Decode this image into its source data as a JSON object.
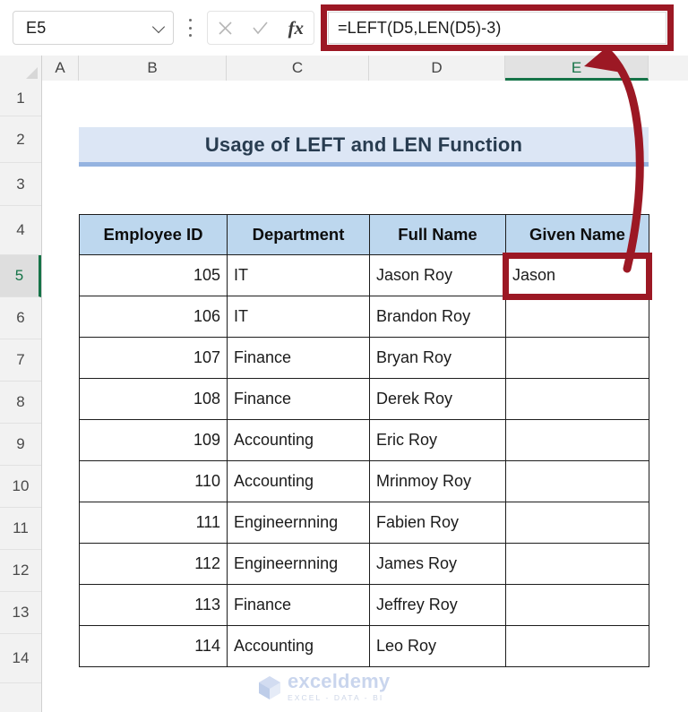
{
  "app": {
    "name_box": {
      "value": "E5",
      "icon": "chevron-down-icon"
    },
    "kebab": "more-options-icon",
    "cancel_icon": "close-icon",
    "enter_icon": "check-icon",
    "insert_function_icon": "fx",
    "formula": "=LEFT(D5,LEN(D5)-3)",
    "accent_selection": "#157347",
    "annotation_color": "#9C1824"
  },
  "grid": {
    "column_headers": [
      "A",
      "B",
      "C",
      "D",
      "E"
    ],
    "selected_column": "E",
    "row_headers": [
      "1",
      "2",
      "3",
      "4",
      "5",
      "6",
      "7",
      "8",
      "9",
      "10",
      "11",
      "12",
      "13",
      "14"
    ],
    "selected_row": "5"
  },
  "banner": {
    "title": "Usage of LEFT and LEN Function",
    "fill": "#DCE6F5",
    "border": "#95B3E0"
  },
  "table": {
    "headers": [
      "Employee ID",
      "Department",
      "Full Name",
      "Given Name"
    ],
    "header_fill": "#BDD7EE",
    "rows": [
      {
        "employee_id": "105",
        "department": "IT",
        "full_name": "Jason Roy",
        "given_name": "Jason"
      },
      {
        "employee_id": "106",
        "department": "IT",
        "full_name": "Brandon Roy",
        "given_name": ""
      },
      {
        "employee_id": "107",
        "department": "Finance",
        "full_name": "Bryan Roy",
        "given_name": ""
      },
      {
        "employee_id": "108",
        "department": "Finance",
        "full_name": "Derek Roy",
        "given_name": ""
      },
      {
        "employee_id": "109",
        "department": "Accounting",
        "full_name": "Eric Roy",
        "given_name": ""
      },
      {
        "employee_id": "110",
        "department": "Accounting",
        "full_name": "Mrinmoy Roy",
        "given_name": ""
      },
      {
        "employee_id": "111",
        "department": "Engineernning",
        "full_name": "Fabien Roy",
        "given_name": ""
      },
      {
        "employee_id": "112",
        "department": "Engineernning",
        "full_name": "James Roy",
        "given_name": ""
      },
      {
        "employee_id": "113",
        "department": "Finance",
        "full_name": "Jeffrey Roy",
        "given_name": ""
      },
      {
        "employee_id": "114",
        "department": "Accounting",
        "full_name": "Leo Roy",
        "given_name": ""
      }
    ]
  },
  "watermark": {
    "name": "exceldemy",
    "tagline": "EXCEL - DATA - BI"
  }
}
